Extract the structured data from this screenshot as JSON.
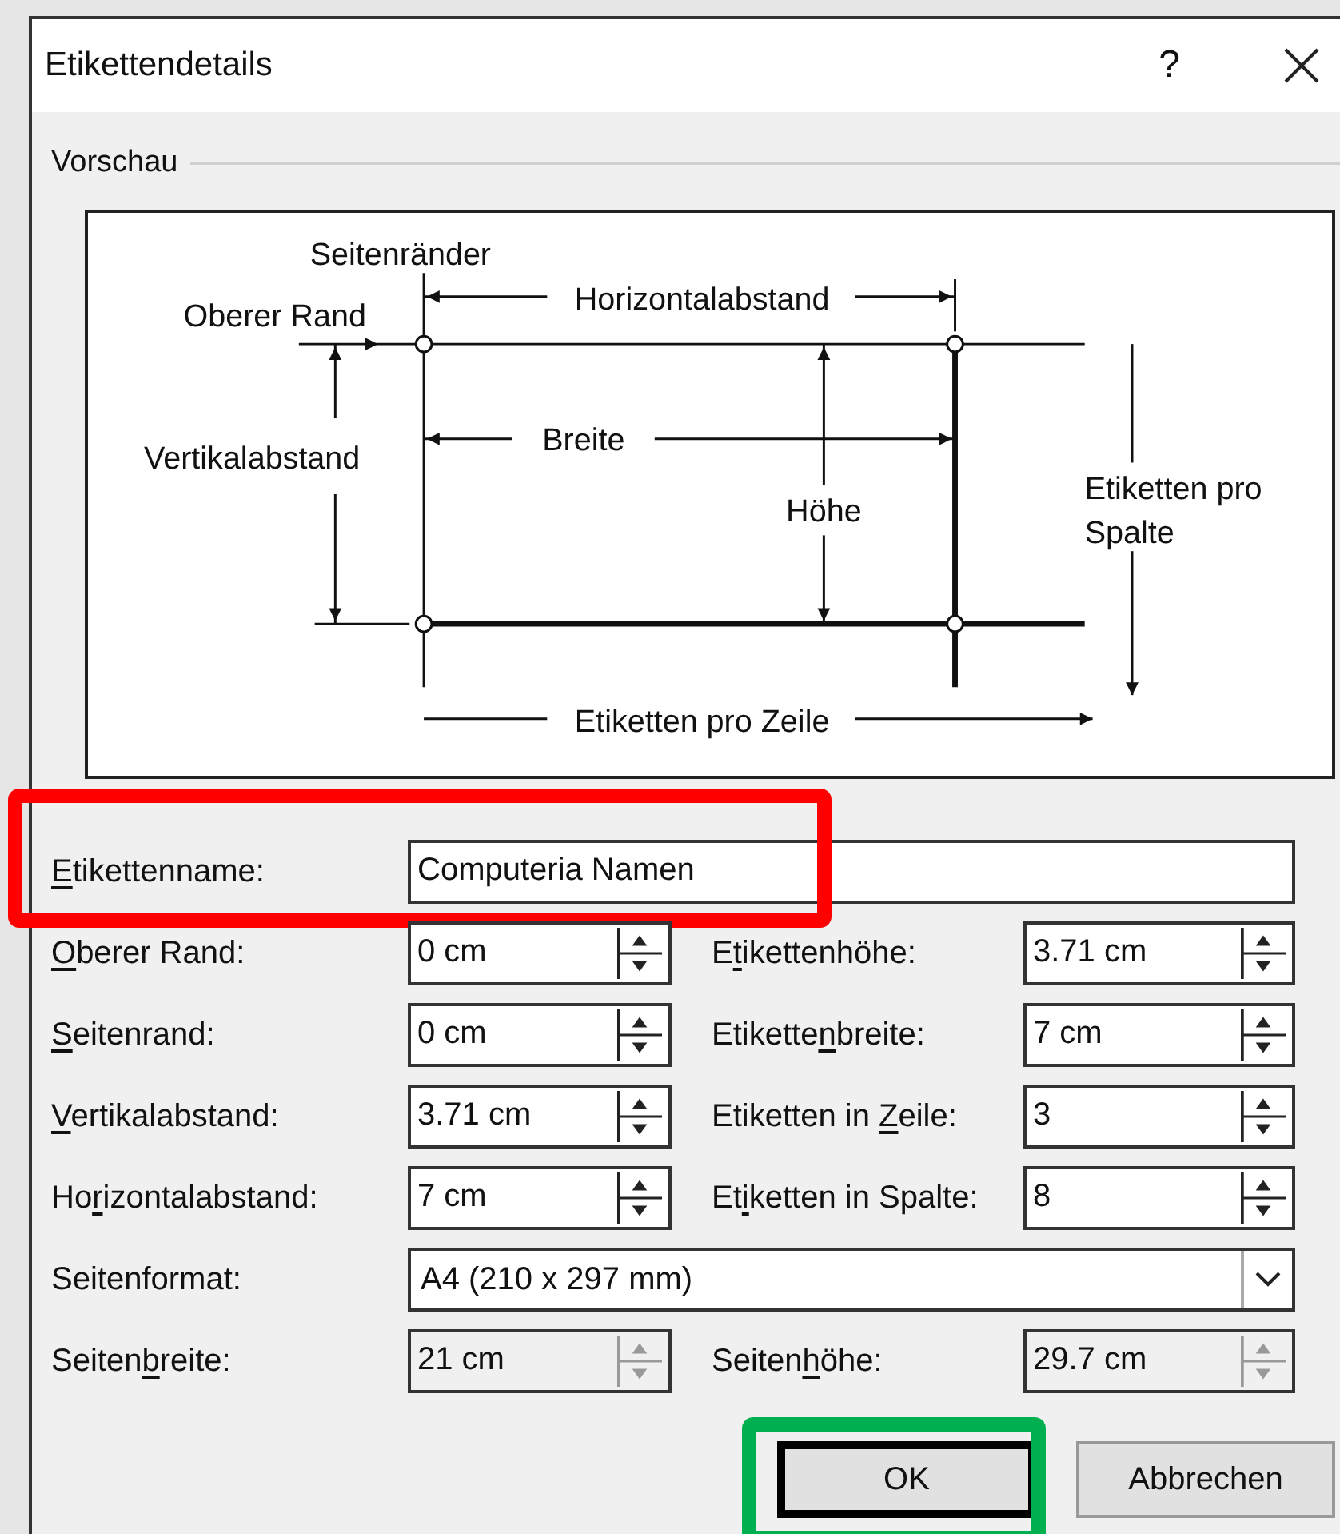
{
  "window": {
    "title": "Etikettendetails",
    "help": "?"
  },
  "preview": {
    "title": "Vorschau",
    "labels": [
      {
        "kind": "margins",
        "text": "Seitenränder"
      },
      {
        "kind": "top_margin",
        "text": "Oberer Rand"
      },
      {
        "kind": "horizontal_pitch",
        "text": "Horizontalabstand"
      },
      {
        "kind": "vertical_pitch",
        "text": "Vertikalabstand"
      },
      {
        "kind": "width",
        "text": "Breite"
      },
      {
        "kind": "height",
        "text": "Höhe"
      },
      {
        "kind": "per_column",
        "lines": [
          "Etiketten pro",
          "Spalte"
        ]
      },
      {
        "kind": "per_row",
        "text": "Etiketten pro Zeile"
      }
    ]
  },
  "form_rows": [
    {
      "cells": [
        {
          "kind": "text",
          "label": {
            "key": "E",
            "after": "tikettenname:"
          },
          "value": "Computeria Namen",
          "color": "#ff0000"
        }
      ]
    },
    {
      "cells": [
        {
          "kind": "spin",
          "label": {
            "key": "O",
            "after": "berer Rand:"
          },
          "value": "0 cm",
          "disabled": false
        },
        {
          "kind": "spin",
          "label": {
            "before": "E",
            "key": "t",
            "after": "ikettenhöhe:"
          },
          "value": "3.71 cm",
          "disabled": false
        }
      ]
    },
    {
      "cells": [
        {
          "kind": "spin",
          "label": {
            "key": "S",
            "after": "eitenrand:"
          },
          "value": "0 cm",
          "disabled": false
        },
        {
          "kind": "spin",
          "label": {
            "before": "Etikette",
            "key": "n",
            "after": "breite:"
          },
          "value": "7 cm",
          "disabled": false
        }
      ]
    },
    {
      "cells": [
        {
          "kind": "spin",
          "label": {
            "key": "V",
            "after": "ertikalabstand:"
          },
          "value": "3.71 cm",
          "disabled": false
        },
        {
          "kind": "spin",
          "label": {
            "before": "Etiketten in ",
            "key": "Z",
            "after": "eile:"
          },
          "value": "3",
          "disabled": false
        }
      ]
    },
    {
      "cells": [
        {
          "kind": "spin",
          "label": {
            "before": "Ho",
            "key": "r",
            "after": "izontalabstand:"
          },
          "value": "7 cm",
          "disabled": false
        },
        {
          "kind": "spin",
          "label": {
            "before": "Et",
            "key": "i",
            "after": "ketten in Spalte:"
          },
          "value": "8",
          "disabled": false
        }
      ]
    },
    {
      "cells": [
        {
          "kind": "dropdown",
          "label": {
            "before": "Seitenformat:"
          },
          "value": "A4 (210 x 297 mm)"
        }
      ]
    },
    {
      "cells": [
        {
          "kind": "spin",
          "label": {
            "before": "Seiten",
            "key": "b",
            "after": "reite:"
          },
          "value": "21 cm",
          "disabled": true
        },
        {
          "kind": "spin",
          "label": {
            "before": "Seiten",
            "key": "h",
            "after": "öhe:"
          },
          "value": "29.7 cm",
          "disabled": true
        }
      ]
    }
  ],
  "buttons": [
    {
      "label": "OK",
      "default": true,
      "color": "#00b050"
    },
    {
      "label": "Abbrechen",
      "default": false
    }
  ]
}
